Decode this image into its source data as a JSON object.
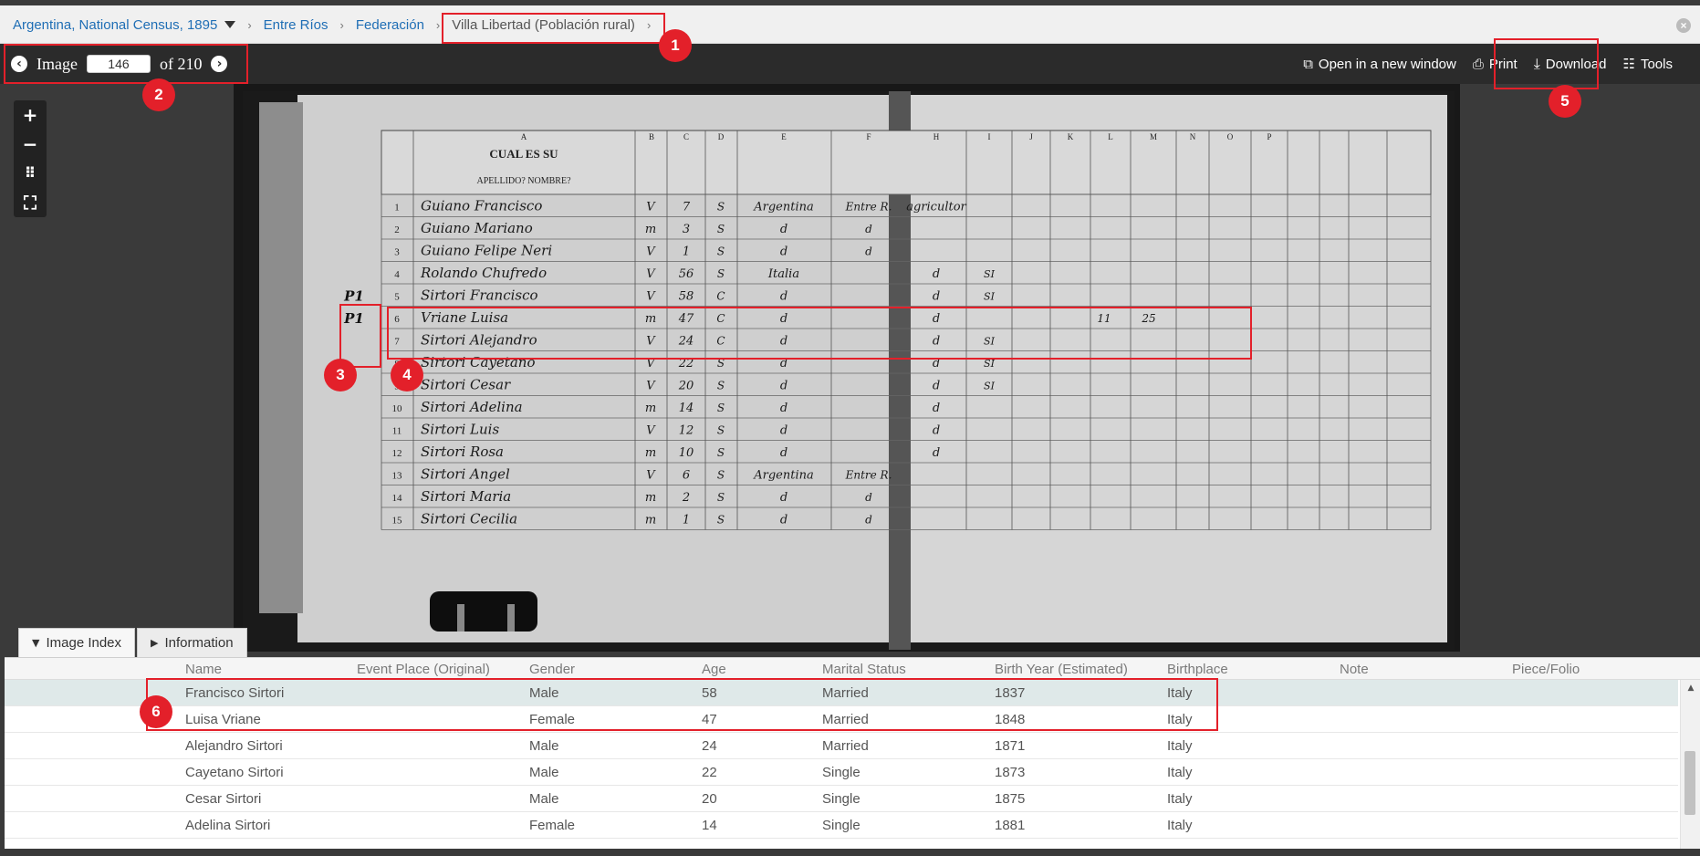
{
  "breadcrumb": {
    "items": [
      "Argentina, National Census, 1895",
      "Entre Ríos",
      "Federación",
      "Villa Libertad (Población rural)"
    ]
  },
  "toolbar": {
    "image_label": "Image",
    "page_value": "146",
    "of_label": "of 210",
    "open_new_window": "Open in a new window",
    "print": "Print",
    "download": "Download",
    "tools": "Tools"
  },
  "tabs": {
    "image_index": "Image Index",
    "information": "Information"
  },
  "table": {
    "headers": [
      "Name",
      "Event Place (Original)",
      "Gender",
      "Age",
      "Marital Status",
      "Birth Year (Estimated)",
      "Birthplace",
      "Note",
      "Piece/Folio"
    ],
    "rows": [
      {
        "name": "Francisco Sirtori",
        "gender": "Male",
        "age": "58",
        "marital": "Married",
        "birth_year": "1837",
        "birthplace": "Italy",
        "selected": true
      },
      {
        "name": "Luisa Vriane",
        "gender": "Female",
        "age": "47",
        "marital": "Married",
        "birth_year": "1848",
        "birthplace": "Italy"
      },
      {
        "name": "Alejandro Sirtori",
        "gender": "Male",
        "age": "24",
        "marital": "Married",
        "birth_year": "1871",
        "birthplace": "Italy"
      },
      {
        "name": "Cayetano Sirtori",
        "gender": "Male",
        "age": "22",
        "marital": "Single",
        "birth_year": "1873",
        "birthplace": "Italy"
      },
      {
        "name": "Cesar Sirtori",
        "gender": "Male",
        "age": "20",
        "marital": "Single",
        "birth_year": "1875",
        "birthplace": "Italy"
      },
      {
        "name": "Adelina Sirtori",
        "gender": "Female",
        "age": "14",
        "marital": "Single",
        "birth_year": "1881",
        "birthplace": "Italy"
      }
    ]
  },
  "scan": {
    "column_letters": [
      "A",
      "B",
      "C",
      "D",
      "E",
      "F",
      "H",
      "I",
      "J",
      "K",
      "L",
      "M",
      "N",
      "O",
      "P"
    ],
    "header_title": "CUAL ES SU",
    "header_sub": "APELLIDO?   NOMBRE?",
    "row_numbers": [
      "1",
      "2",
      "3",
      "4",
      "5",
      "6",
      "7",
      "8",
      "9",
      "10",
      "11",
      "12",
      "13",
      "14",
      "15"
    ],
    "margin_marks": [
      "P1",
      "P1"
    ],
    "row_entries": [
      {
        "name": "Guiano Francisco",
        "sex": "V",
        "age": "7",
        "status": "S",
        "nation": "Argentina",
        "prov": "Entre R.",
        "occ": "agricultor",
        "read": ""
      },
      {
        "name": "Guiano Mariano",
        "sex": "m",
        "age": "3",
        "status": "S",
        "nation": "d",
        "prov": "d",
        "occ": "",
        "read": ""
      },
      {
        "name": "Guiano Felipe Neri",
        "sex": "V",
        "age": "1",
        "status": "S",
        "nation": "d",
        "prov": "d",
        "occ": "",
        "read": ""
      },
      {
        "name": "Rolando Chufredo",
        "sex": "V",
        "age": "56",
        "status": "S",
        "nation": "Italia",
        "prov": "",
        "occ": "d",
        "read": "SI"
      },
      {
        "name": "Sirtori Francisco",
        "sex": "V",
        "age": "58",
        "status": "C",
        "nation": "d",
        "prov": "",
        "occ": "d",
        "read": "SI"
      },
      {
        "name": "Vriane Luisa",
        "sex": "m",
        "age": "47",
        "status": "C",
        "nation": "d",
        "prov": "",
        "occ": "d",
        "read": "",
        "children": "11",
        "years": "25"
      },
      {
        "name": "Sirtori Alejandro",
        "sex": "V",
        "age": "24",
        "status": "C",
        "nation": "d",
        "prov": "",
        "occ": "d",
        "read": "SI"
      },
      {
        "name": "Sirtori Cayetano",
        "sex": "V",
        "age": "22",
        "status": "S",
        "nation": "d",
        "prov": "",
        "occ": "d",
        "read": "SI"
      },
      {
        "name": "Sirtori Cesar",
        "sex": "V",
        "age": "20",
        "status": "S",
        "nation": "d",
        "prov": "",
        "occ": "d",
        "read": "SI"
      },
      {
        "name": "Sirtori Adelina",
        "sex": "m",
        "age": "14",
        "status": "S",
        "nation": "d",
        "prov": "",
        "occ": "d",
        "read": ""
      },
      {
        "name": "Sirtori Luis",
        "sex": "V",
        "age": "12",
        "status": "S",
        "nation": "d",
        "prov": "",
        "occ": "d",
        "read": ""
      },
      {
        "name": "Sirtori Rosa",
        "sex": "m",
        "age": "10",
        "status": "S",
        "nation": "d",
        "prov": "",
        "occ": "d",
        "read": ""
      },
      {
        "name": "Sirtori Angel",
        "sex": "V",
        "age": "6",
        "status": "S",
        "nation": "Argentina",
        "prov": "Entre R.",
        "occ": "",
        "read": ""
      },
      {
        "name": "Sirtori Maria",
        "sex": "m",
        "age": "2",
        "status": "S",
        "nation": "d",
        "prov": "d",
        "occ": "",
        "read": ""
      },
      {
        "name": "Sirtori Cecilia",
        "sex": "m",
        "age": "1",
        "status": "S",
        "nation": "d",
        "prov": "d",
        "occ": "",
        "read": ""
      }
    ]
  },
  "annotations": {
    "labels": [
      "1",
      "2",
      "3",
      "4",
      "5",
      "6"
    ]
  },
  "colors": {
    "annotation_red": "#e3202a",
    "link_blue": "#1f6eb5",
    "toolbar_bg": "#2b2b2b",
    "selected_row": "#dfe9e9"
  }
}
